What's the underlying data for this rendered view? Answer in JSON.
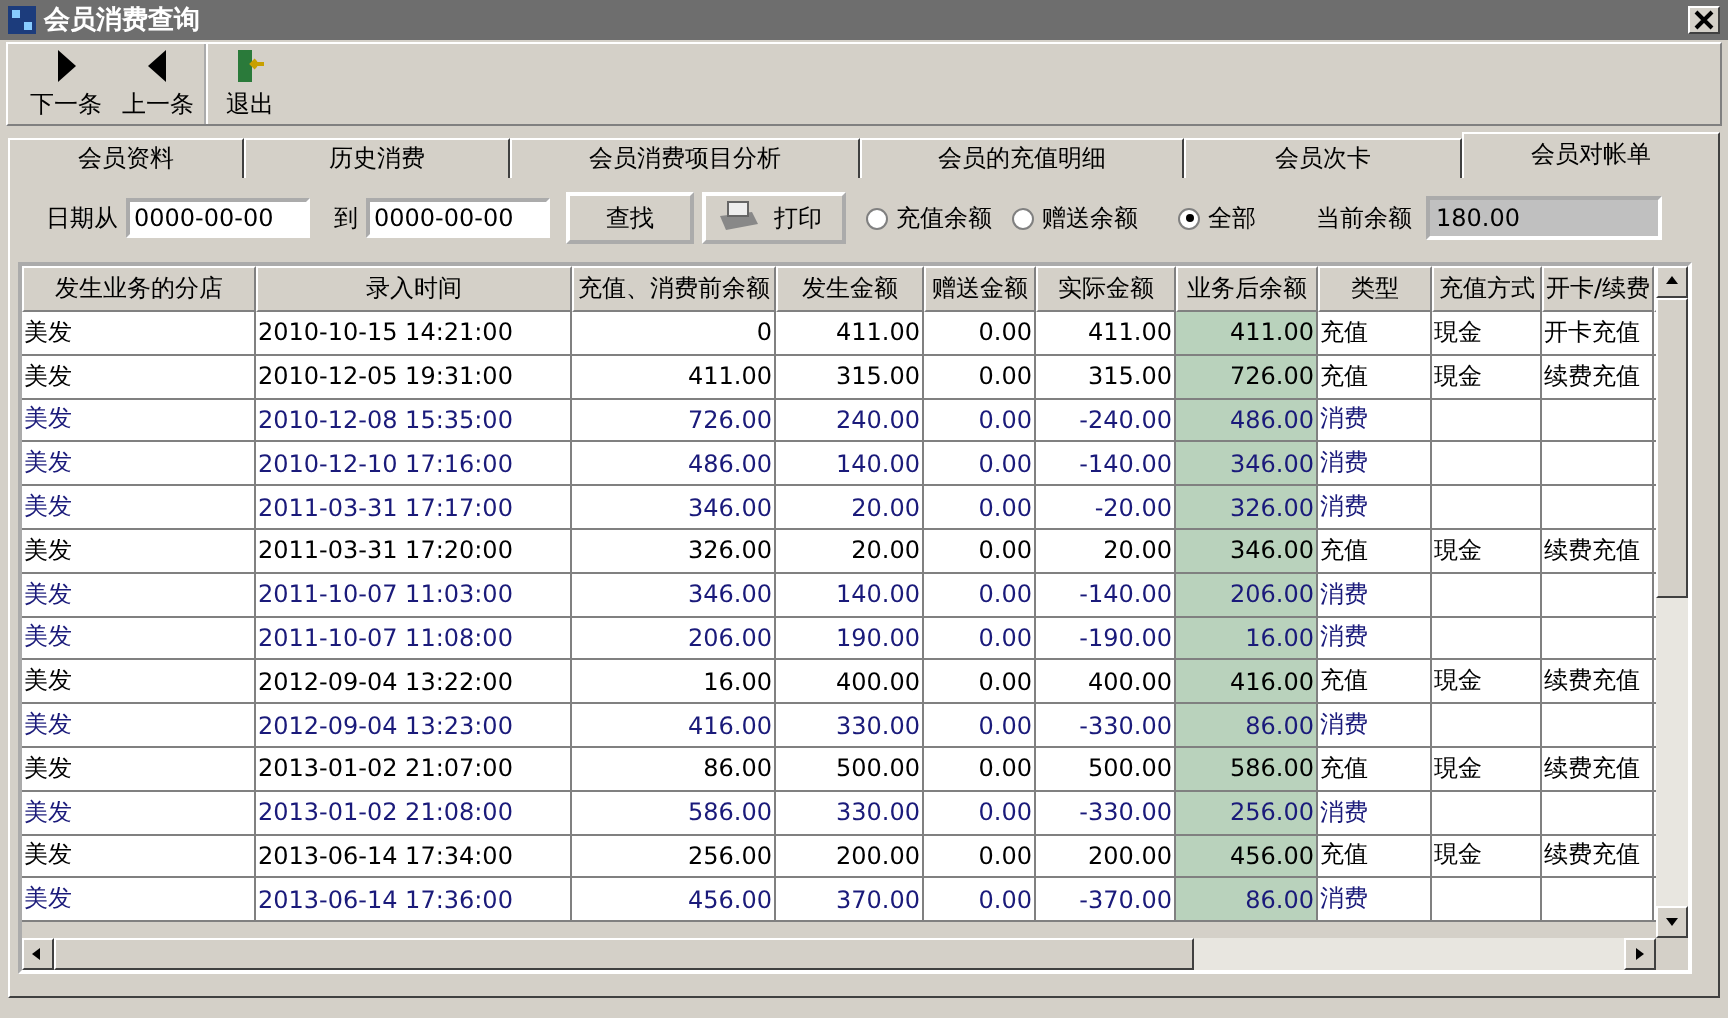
{
  "window": {
    "title": "会员消费查询"
  },
  "toolbar": [
    {
      "label": "下一条",
      "kind": "next"
    },
    {
      "label": "上一条",
      "kind": "prev"
    },
    {
      "label": "退出",
      "kind": "exit"
    }
  ],
  "tabs": [
    {
      "label": "会员资料",
      "selected": false
    },
    {
      "label": "历史消费",
      "selected": false
    },
    {
      "label": "会员消费项目分析",
      "selected": false
    },
    {
      "label": "会员的充值明细",
      "selected": false
    },
    {
      "label": "会员次卡",
      "selected": false
    },
    {
      "label": "会员对帐单",
      "selected": true
    }
  ],
  "filter": {
    "from_label": "日期从",
    "from_value": "0000-00-00",
    "to_label": "到",
    "to_value": "0000-00-00",
    "search_button": "查找",
    "print_button": "打印",
    "radios": [
      {
        "label": "充值余额",
        "selected": false
      },
      {
        "label": "赠送余额",
        "selected": false
      },
      {
        "label": "全部",
        "selected": true
      }
    ],
    "balance_label": "当前余额",
    "balance_value": "180.00"
  },
  "table": {
    "columns": [
      "发生业务的分店",
      "录入时间",
      "充值、消费前余额",
      "发生金额",
      "赠送金额",
      "实际金额",
      "业务后余额",
      "类型",
      "充值方式",
      "开卡/续费"
    ],
    "rows": [
      {
        "kind": "recharge",
        "cells": [
          "美发",
          "2010-10-15 14:21:00",
          "0",
          "411.00",
          "0.00",
          "411.00",
          "411.00",
          "充值",
          "現金",
          "开卡充值"
        ]
      },
      {
        "kind": "recharge",
        "cells": [
          "美发",
          "2010-12-05 19:31:00",
          "411.00",
          "315.00",
          "0.00",
          "315.00",
          "726.00",
          "充值",
          "現金",
          "续费充值"
        ]
      },
      {
        "kind": "consume",
        "cells": [
          "美发",
          "2010-12-08 15:35:00",
          "726.00",
          "240.00",
          "0.00",
          "-240.00",
          "486.00",
          "消费",
          "",
          ""
        ]
      },
      {
        "kind": "consume",
        "cells": [
          "美发",
          "2010-12-10 17:16:00",
          "486.00",
          "140.00",
          "0.00",
          "-140.00",
          "346.00",
          "消费",
          "",
          ""
        ]
      },
      {
        "kind": "consume",
        "cells": [
          "美发",
          "2011-03-31 17:17:00",
          "346.00",
          "20.00",
          "0.00",
          "-20.00",
          "326.00",
          "消费",
          "",
          ""
        ]
      },
      {
        "kind": "recharge",
        "cells": [
          "美发",
          "2011-03-31 17:20:00",
          "326.00",
          "20.00",
          "0.00",
          "20.00",
          "346.00",
          "充值",
          "現金",
          "续费充值"
        ]
      },
      {
        "kind": "consume",
        "cells": [
          "美发",
          "2011-10-07 11:03:00",
          "346.00",
          "140.00",
          "0.00",
          "-140.00",
          "206.00",
          "消费",
          "",
          ""
        ]
      },
      {
        "kind": "consume",
        "cells": [
          "美发",
          "2011-10-07 11:08:00",
          "206.00",
          "190.00",
          "0.00",
          "-190.00",
          "16.00",
          "消费",
          "",
          ""
        ]
      },
      {
        "kind": "recharge",
        "cells": [
          "美发",
          "2012-09-04 13:22:00",
          "16.00",
          "400.00",
          "0.00",
          "400.00",
          "416.00",
          "充值",
          "現金",
          "续费充值"
        ]
      },
      {
        "kind": "consume",
        "cells": [
          "美发",
          "2012-09-04 13:23:00",
          "416.00",
          "330.00",
          "0.00",
          "-330.00",
          "86.00",
          "消费",
          "",
          ""
        ]
      },
      {
        "kind": "recharge",
        "cells": [
          "美发",
          "2013-01-02 21:07:00",
          "86.00",
          "500.00",
          "0.00",
          "500.00",
          "586.00",
          "充值",
          "現金",
          "续费充值"
        ]
      },
      {
        "kind": "consume",
        "cells": [
          "美发",
          "2013-01-02 21:08:00",
          "586.00",
          "330.00",
          "0.00",
          "-330.00",
          "256.00",
          "消费",
          "",
          ""
        ]
      },
      {
        "kind": "recharge",
        "cells": [
          "美发",
          "2013-06-14 17:34:00",
          "256.00",
          "200.00",
          "0.00",
          "200.00",
          "456.00",
          "充值",
          "現金",
          "续费充值"
        ]
      },
      {
        "kind": "consume",
        "cells": [
          "美发",
          "2013-06-14 17:36:00",
          "456.00",
          "370.00",
          "0.00",
          "-370.00",
          "86.00",
          "消费",
          "",
          ""
        ]
      }
    ]
  }
}
